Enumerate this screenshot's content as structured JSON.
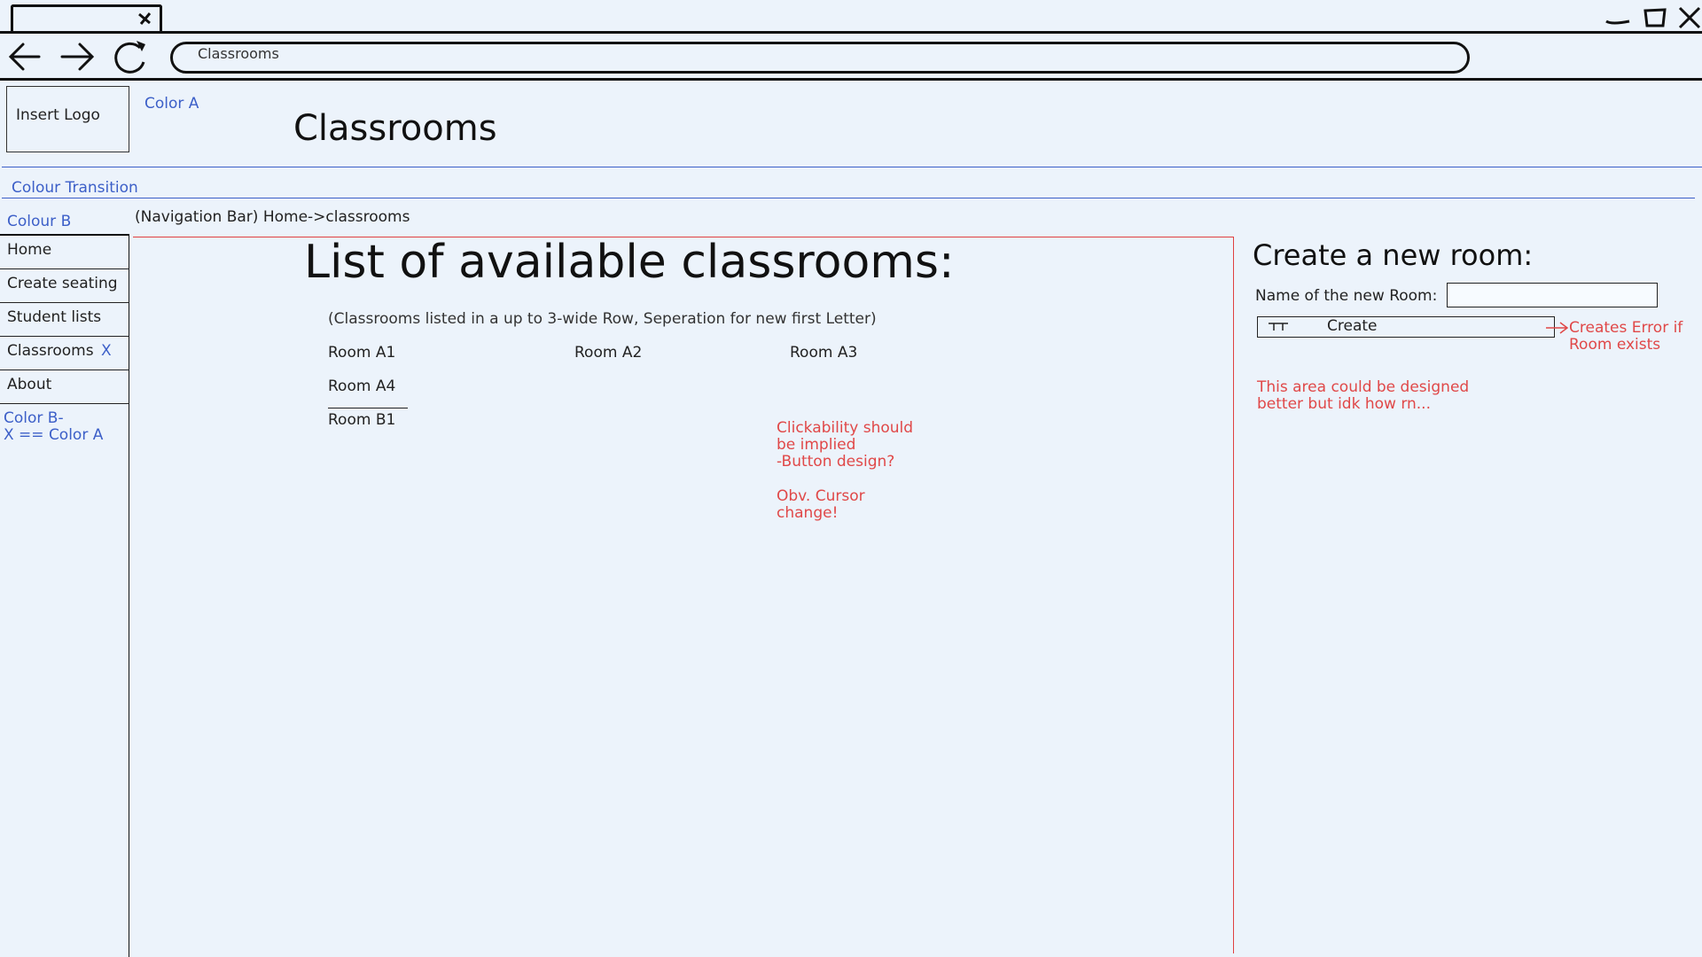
{
  "browser": {
    "address": "Classrooms"
  },
  "header": {
    "logo": "Insert Logo",
    "color_a_note": "Color A",
    "title": "Classrooms",
    "transition_note": "Colour Transition"
  },
  "sidebar": {
    "colour_note": "Colour B",
    "items": [
      {
        "label": "Home"
      },
      {
        "label": "Create seating"
      },
      {
        "label": "Student lists"
      },
      {
        "label": "Classrooms",
        "marker": "X"
      },
      {
        "label": "About"
      }
    ],
    "legend_line1": "Color B-",
    "legend_line2": "X == Color A"
  },
  "breadcrumb": "(Navigation Bar) Home->classrooms",
  "main": {
    "title": "List of available classrooms:",
    "hint": "(Classrooms listed in a up to 3-wide Row, Seperation for new first Letter)",
    "rooms": [
      "Room A1",
      "Room A2",
      "Room A3",
      "Room A4",
      "Room B1"
    ],
    "note_clickability": "Clickability should\nbe implied\n-Button design?",
    "note_cursor": "Obv. Cursor\nchange!"
  },
  "create_panel": {
    "title": "Create a new room:",
    "name_label": "Name of the new Room:",
    "name_value": "",
    "button_label": "Create",
    "note_error": "Creates Error if\nRoom exists",
    "note_design": "This area could be designed\nbetter but idk how rn..."
  },
  "colors": {
    "background": "#ecf3fb",
    "annotation_blue": "#3c5fc8",
    "annotation_red": "#e04848"
  }
}
